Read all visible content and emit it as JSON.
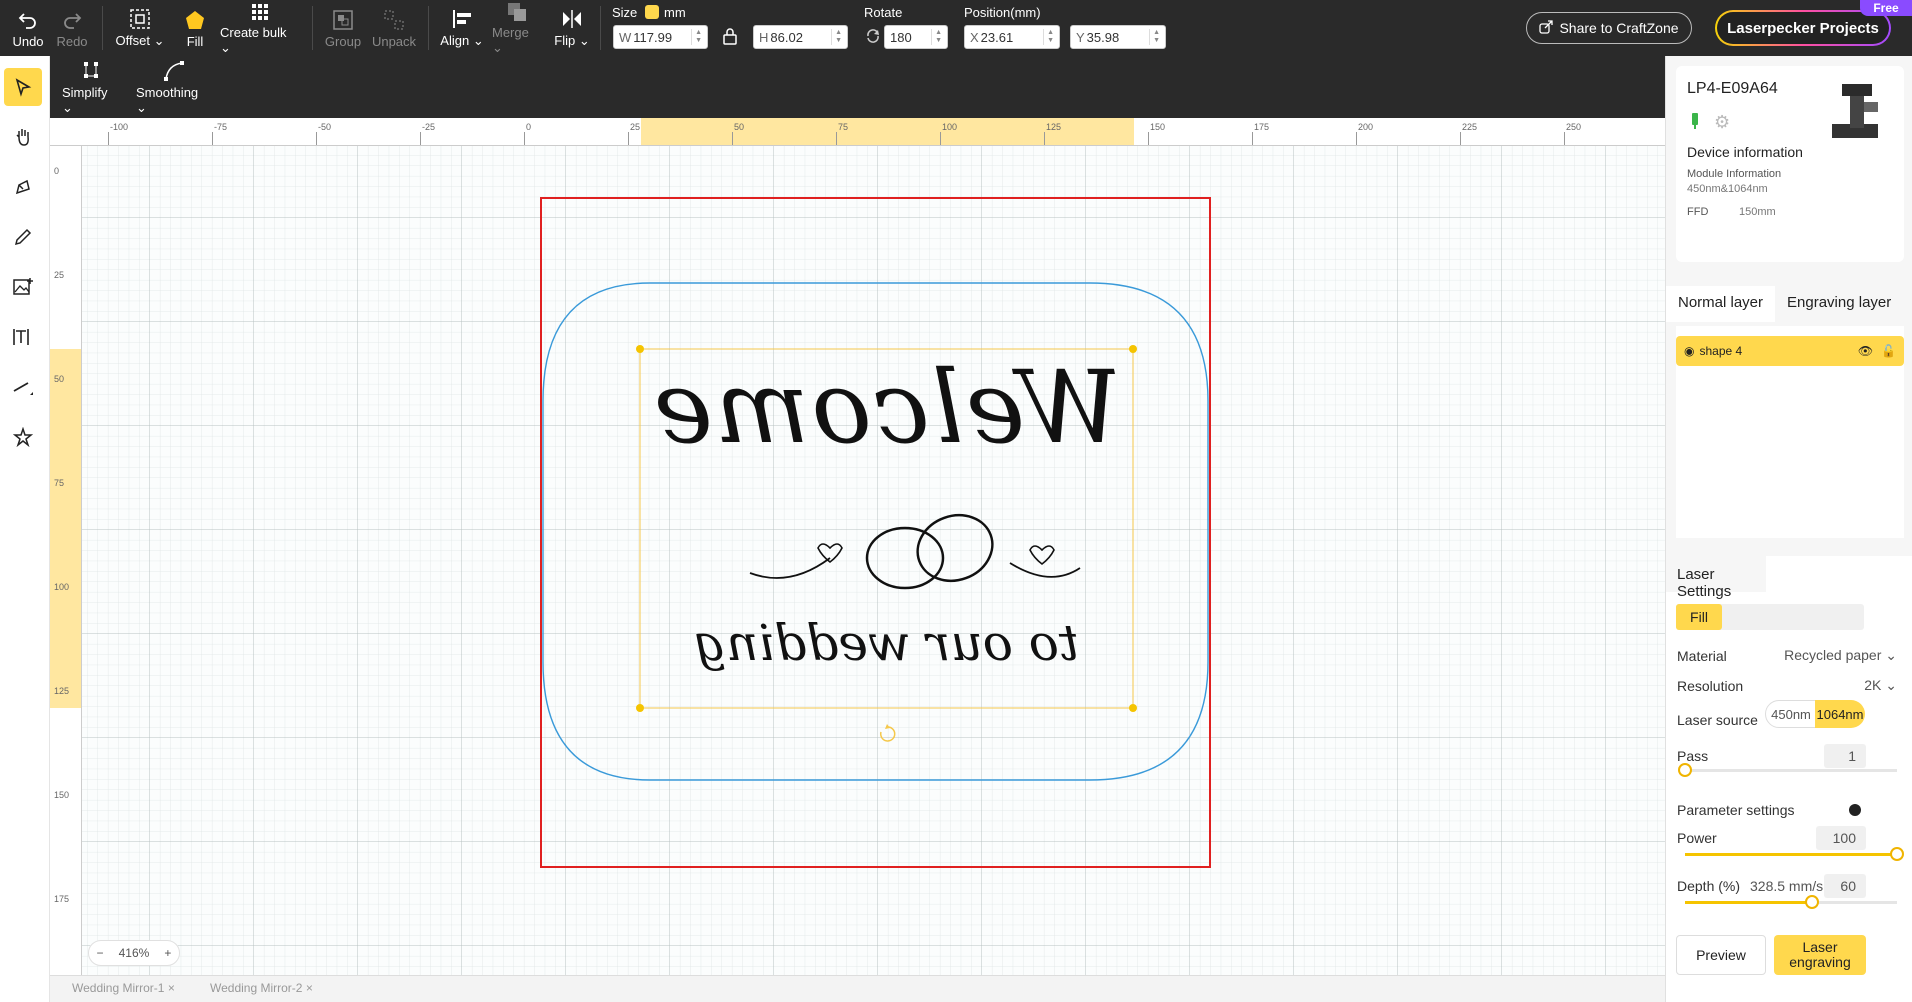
{
  "toolbar": {
    "undo": "Undo",
    "redo": "Redo",
    "offset": "Offset",
    "fill": "Fill",
    "create_bulk": "Create bulk",
    "group": "Group",
    "unpack": "Unpack",
    "align": "Align",
    "merge": "Merge",
    "flip": "Flip",
    "size_label": "Size",
    "size_unit": "mm",
    "w_prefix": "W",
    "w_value": "117.99",
    "h_prefix": "H",
    "h_value": "86.02",
    "rotate_label": "Rotate",
    "rotate_value": "180",
    "position_label": "Position(mm)",
    "x_prefix": "X",
    "x_value": "23.61",
    "y_prefix": "Y",
    "y_value": "35.98",
    "share": "Share to CraftZone",
    "projects": "Laserpecker Projects",
    "free_badge": "Free"
  },
  "subtoolbar": {
    "simplify": "Simplify",
    "smoothing": "Smoothing"
  },
  "rulers": {
    "h_ticks": [
      "-100",
      "-75",
      "-50",
      "-25",
      "0",
      "25",
      "50",
      "75",
      "100",
      "125",
      "150",
      "175",
      "200",
      "225",
      "250"
    ],
    "v_ticks": [
      "0",
      "25",
      "50",
      "75",
      "100",
      "125",
      "150",
      "175"
    ]
  },
  "canvas": {
    "title_text": "Welcome",
    "sub_text": "to our wedding",
    "zoom": "416%",
    "zoom_minus": "−",
    "zoom_plus": "+"
  },
  "tabs_bottom": [
    "Wedding Mirror-1",
    "Wedding Mirror-2"
  ],
  "device": {
    "name": "LP4-E09A64",
    "info_title": "Device information",
    "module_label": "Module Information",
    "module_value": "450nm&1064nm",
    "ffd_label": "FFD",
    "ffd_value": "150mm"
  },
  "layers": {
    "normal_tab": "Normal layer",
    "engraving_tab": "Engraving layer",
    "item": "shape 4"
  },
  "laser": {
    "title": "Laser Settings",
    "mode": "Fill",
    "material_label": "Material",
    "material_value": "Recycled paper",
    "resolution_label": "Resolution",
    "resolution_value": "2K",
    "source_label": "Laser source",
    "source_a": "450nm",
    "source_b": "1064nm",
    "pass_label": "Pass",
    "pass_value": "1",
    "param_label": "Parameter settings",
    "power_label": "Power",
    "power_value": "100",
    "depth_label": "Depth (%)",
    "speed_value": "328.5 mm/s",
    "depth_value": "60",
    "preview": "Preview",
    "engrave": "Laser engraving"
  },
  "colors": {
    "accent": "#ffd84d",
    "toolbar": "#2a2a2a",
    "work_area": "#e02020",
    "outline": "#3a9ad9"
  },
  "sliders": {
    "pass_fraction": 0.0,
    "power_fraction": 1.0,
    "depth_fraction": 0.6
  }
}
